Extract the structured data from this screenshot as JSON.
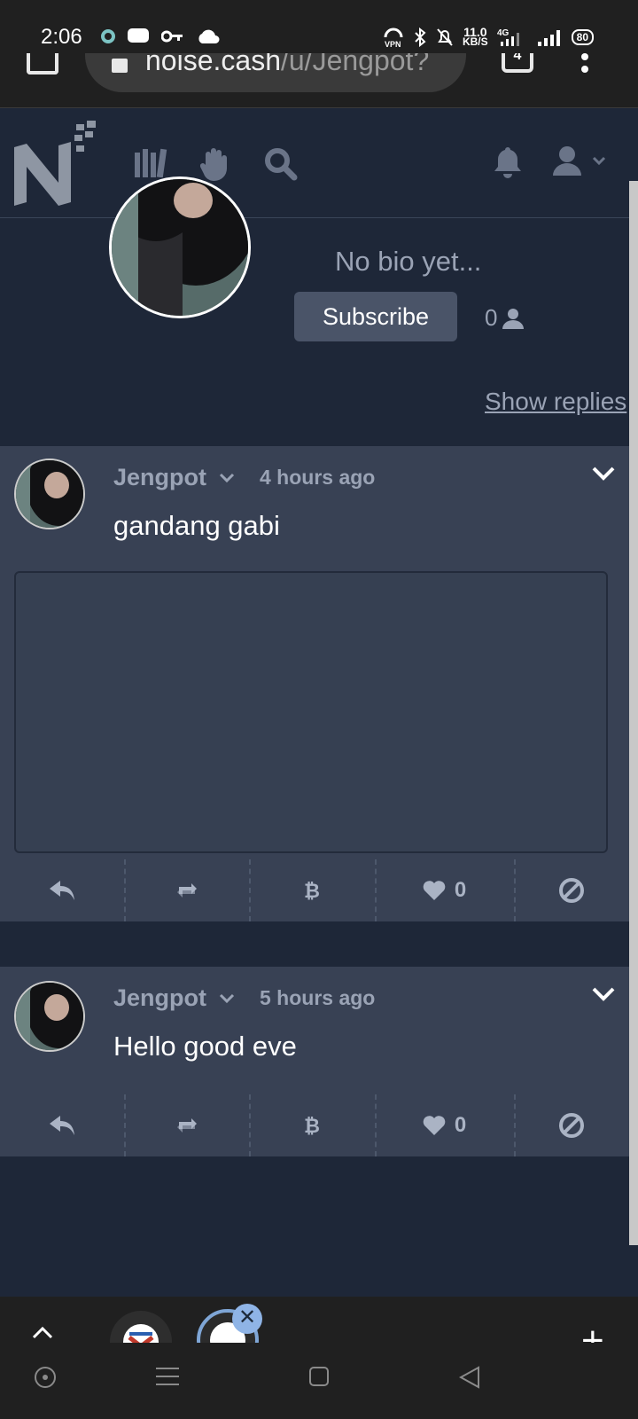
{
  "status_bar": {
    "time": "2:06",
    "speed_value": "11.0",
    "speed_unit": "KB/S",
    "network": "4G",
    "vpn": "VPN",
    "battery": "80"
  },
  "browser": {
    "url_main": "noise.cash",
    "url_path": "/u/Jengpot?",
    "tab_count": "4"
  },
  "profile": {
    "bio": "No bio yet...",
    "subscribe_label": "Subscribe",
    "subscriber_count": "0",
    "show_replies": "Show replies"
  },
  "posts": [
    {
      "author": "Jengpot",
      "time": "4 hours ago",
      "text": "gandang gabi",
      "has_media": true,
      "likes": "0"
    },
    {
      "author": "Jengpot",
      "time": "5 hours ago",
      "text": "Hello good eve",
      "has_media": false,
      "likes": "0"
    }
  ],
  "colors": {
    "background": "#1e2738",
    "card": "#384154",
    "muted_text": "#9aa3b5",
    "button": "#4a5468"
  }
}
